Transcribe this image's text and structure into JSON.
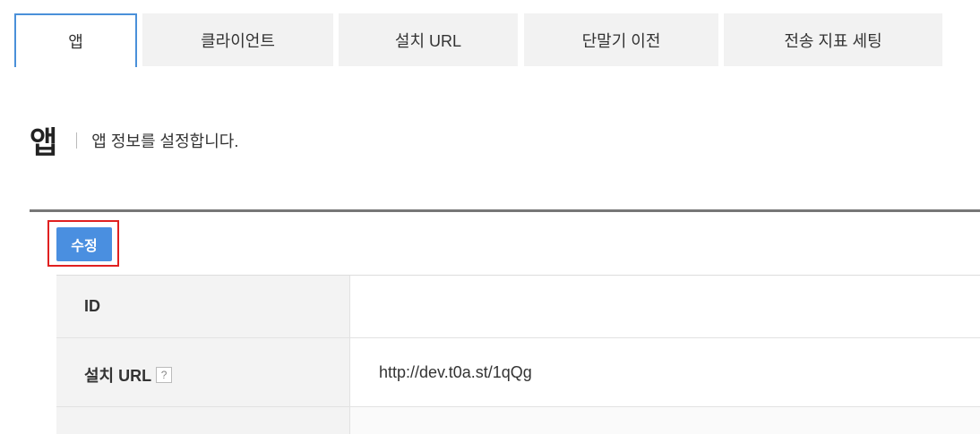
{
  "tabs": [
    {
      "label": "앱",
      "active": true
    },
    {
      "label": "클라이언트",
      "active": false
    },
    {
      "label": "설치 URL",
      "active": false
    },
    {
      "label": "단말기 이전",
      "active": false
    },
    {
      "label": "전송 지표 세팅",
      "active": false
    }
  ],
  "section": {
    "title": "앱",
    "description": "앱 정보를 설정합니다."
  },
  "toolbar": {
    "edit_label": "수정"
  },
  "fields": [
    {
      "label": "ID",
      "value": ""
    },
    {
      "label": "설치 URL",
      "value": "http://dev.t0a.st/1qQg",
      "help": "?"
    },
    {
      "label": "",
      "value": ""
    }
  ],
  "colors": {
    "accent": "#4a8fe0",
    "highlight": "#e02020",
    "tab_bg": "#f2f2f2",
    "label_bg": "#f3f3f3"
  }
}
